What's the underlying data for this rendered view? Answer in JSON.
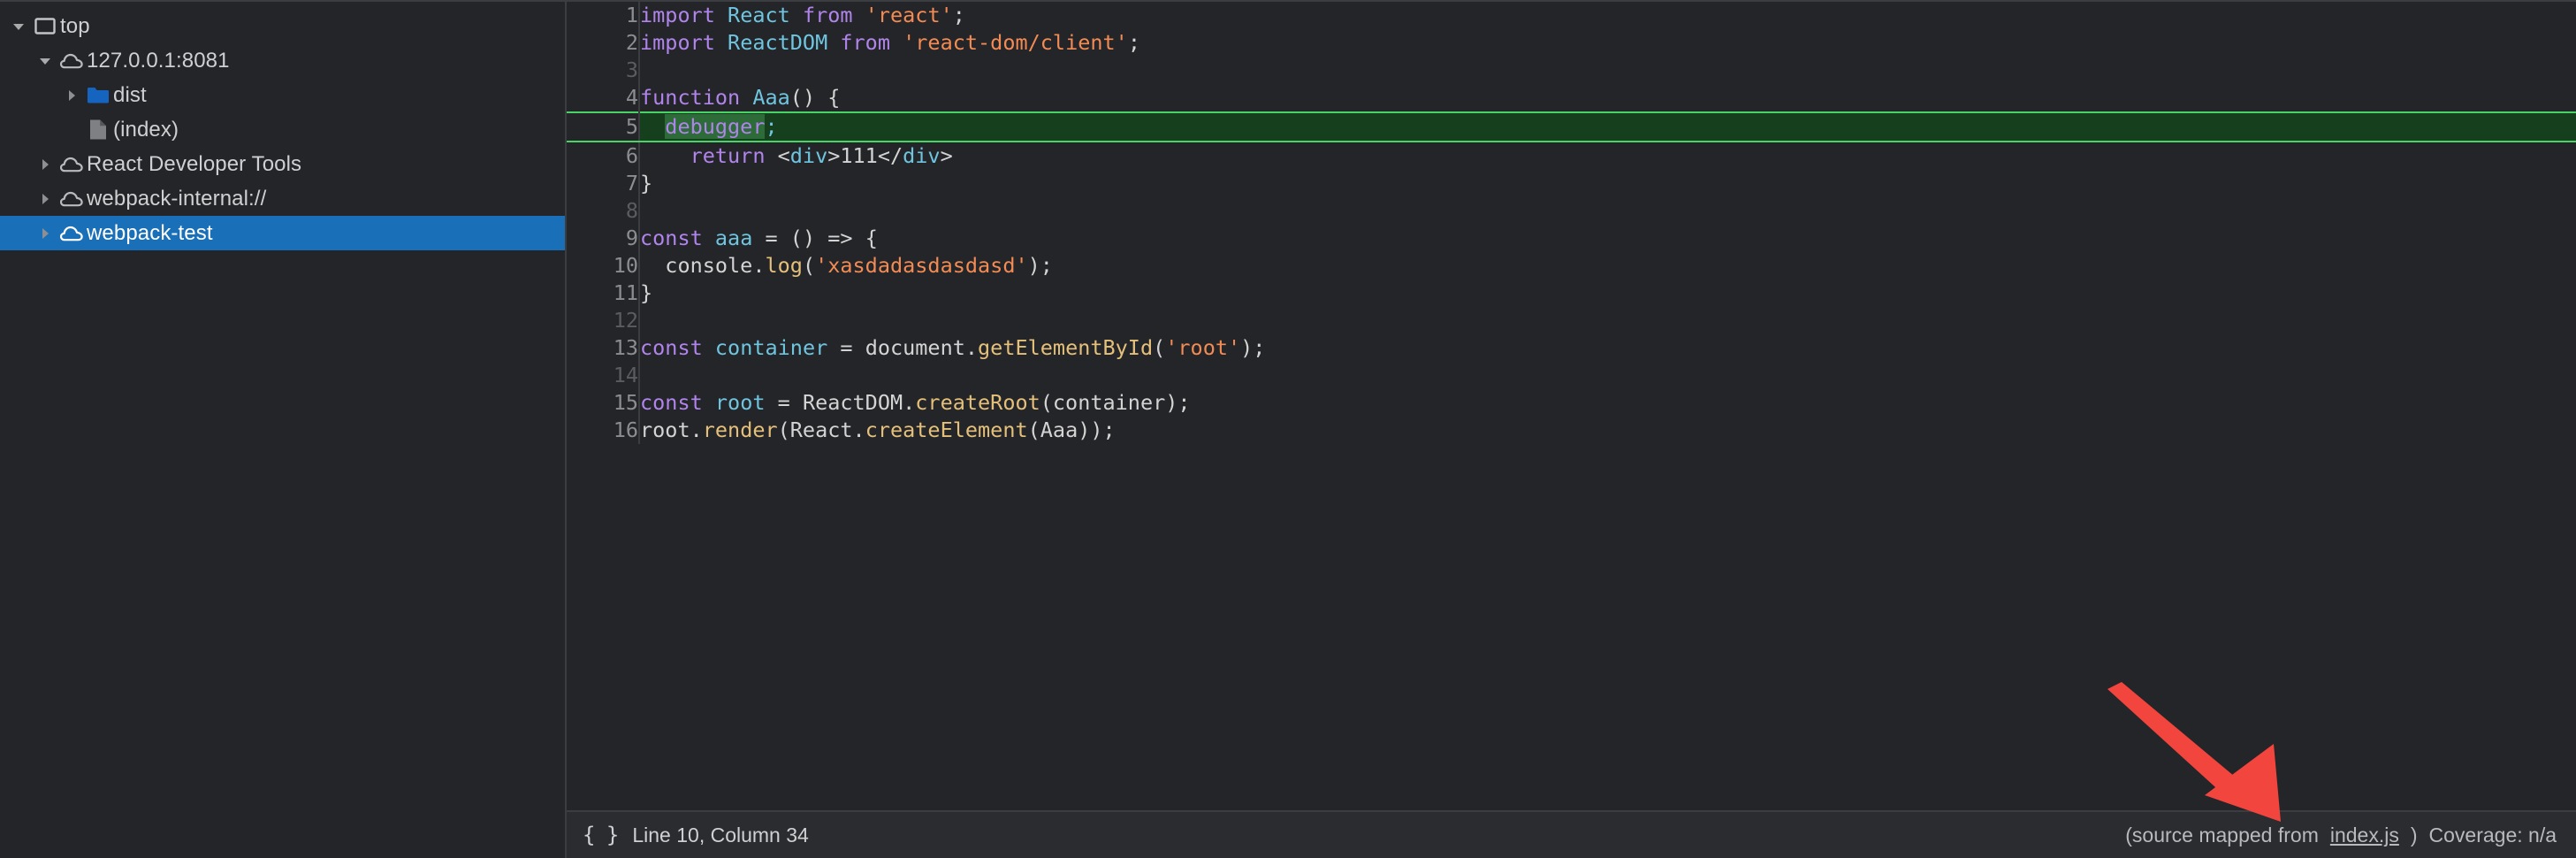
{
  "navigator": {
    "tree": [
      {
        "label": "top",
        "icon": "frame-icon",
        "twisty": "expanded",
        "indent": 0,
        "selected": false
      },
      {
        "label": "127.0.0.1:8081",
        "icon": "cloud-icon",
        "twisty": "expanded",
        "indent": 1,
        "selected": false
      },
      {
        "label": "dist",
        "icon": "folder-icon",
        "twisty": "collapsed",
        "indent": 2,
        "selected": false
      },
      {
        "label": "(index)",
        "icon": "file-icon",
        "twisty": "none",
        "indent": 2,
        "selected": false
      },
      {
        "label": "React Developer Tools",
        "icon": "cloud-icon",
        "twisty": "collapsed",
        "indent": 1,
        "selected": false
      },
      {
        "label": "webpack-internal://",
        "icon": "cloud-icon",
        "twisty": "collapsed",
        "indent": 1,
        "selected": false
      },
      {
        "label": "webpack-test",
        "icon": "cloud-icon",
        "twisty": "collapsed",
        "indent": 1,
        "selected": true
      }
    ],
    "selection_color": "#1a70b8"
  },
  "editor": {
    "language": "javascript",
    "paused_line": 5,
    "lines": [
      {
        "n": 1,
        "blank": false,
        "exec": false,
        "tokens": [
          {
            "t": "import",
            "c": "kw"
          },
          {
            "t": " ",
            "c": "plain"
          },
          {
            "t": "React",
            "c": "var"
          },
          {
            "t": " ",
            "c": "plain"
          },
          {
            "t": "from",
            "c": "kw"
          },
          {
            "t": " ",
            "c": "plain"
          },
          {
            "t": "'react'",
            "c": "str"
          },
          {
            "t": ";",
            "c": "punc"
          }
        ]
      },
      {
        "n": 2,
        "blank": false,
        "exec": false,
        "tokens": [
          {
            "t": "import",
            "c": "kw"
          },
          {
            "t": " ",
            "c": "plain"
          },
          {
            "t": "ReactDOM",
            "c": "var"
          },
          {
            "t": " ",
            "c": "plain"
          },
          {
            "t": "from",
            "c": "kw"
          },
          {
            "t": " ",
            "c": "plain"
          },
          {
            "t": "'react-dom/client'",
            "c": "str"
          },
          {
            "t": ";",
            "c": "punc"
          }
        ]
      },
      {
        "n": 3,
        "blank": true,
        "exec": false,
        "tokens": []
      },
      {
        "n": 4,
        "blank": false,
        "exec": false,
        "tokens": [
          {
            "t": "function",
            "c": "kw"
          },
          {
            "t": " ",
            "c": "plain"
          },
          {
            "t": "Aaa",
            "c": "var"
          },
          {
            "t": "() {",
            "c": "punc"
          }
        ]
      },
      {
        "n": 5,
        "blank": false,
        "exec": true,
        "tokens": [
          {
            "t": "  ",
            "c": "plain"
          },
          {
            "t": "debugger",
            "c": "kw paused"
          },
          {
            "t": ";",
            "c": "var"
          }
        ]
      },
      {
        "n": 6,
        "blank": false,
        "exec": false,
        "tokens": [
          {
            "t": "    ",
            "c": "plain"
          },
          {
            "t": "return",
            "c": "kw"
          },
          {
            "t": " <",
            "c": "punc"
          },
          {
            "t": "div",
            "c": "var"
          },
          {
            "t": ">",
            "c": "punc"
          },
          {
            "t": "111",
            "c": "num"
          },
          {
            "t": "</",
            "c": "punc"
          },
          {
            "t": "div",
            "c": "var"
          },
          {
            "t": ">",
            "c": "punc"
          }
        ]
      },
      {
        "n": 7,
        "blank": false,
        "exec": false,
        "tokens": [
          {
            "t": "}",
            "c": "punc"
          }
        ]
      },
      {
        "n": 8,
        "blank": true,
        "exec": false,
        "tokens": []
      },
      {
        "n": 9,
        "blank": false,
        "exec": false,
        "tokens": [
          {
            "t": "const",
            "c": "kw"
          },
          {
            "t": " ",
            "c": "plain"
          },
          {
            "t": "aaa",
            "c": "var"
          },
          {
            "t": " = () => {",
            "c": "punc"
          }
        ]
      },
      {
        "n": 10,
        "blank": false,
        "exec": false,
        "tokens": [
          {
            "t": "  console.",
            "c": "plain"
          },
          {
            "t": "log",
            "c": "fn"
          },
          {
            "t": "(",
            "c": "punc"
          },
          {
            "t": "'xasdadasdasdasd'",
            "c": "str"
          },
          {
            "t": ");",
            "c": "punc"
          }
        ]
      },
      {
        "n": 11,
        "blank": false,
        "exec": false,
        "tokens": [
          {
            "t": "}",
            "c": "punc"
          }
        ]
      },
      {
        "n": 12,
        "blank": true,
        "exec": false,
        "tokens": []
      },
      {
        "n": 13,
        "blank": false,
        "exec": false,
        "tokens": [
          {
            "t": "const",
            "c": "kw"
          },
          {
            "t": " ",
            "c": "plain"
          },
          {
            "t": "container",
            "c": "var"
          },
          {
            "t": " = document.",
            "c": "plain"
          },
          {
            "t": "getElementById",
            "c": "fn"
          },
          {
            "t": "(",
            "c": "punc"
          },
          {
            "t": "'root'",
            "c": "str"
          },
          {
            "t": ");",
            "c": "punc"
          }
        ]
      },
      {
        "n": 14,
        "blank": true,
        "exec": false,
        "tokens": []
      },
      {
        "n": 15,
        "blank": false,
        "exec": false,
        "tokens": [
          {
            "t": "const",
            "c": "kw"
          },
          {
            "t": " ",
            "c": "plain"
          },
          {
            "t": "root",
            "c": "var"
          },
          {
            "t": " = ReactDOM.",
            "c": "plain"
          },
          {
            "t": "createRoot",
            "c": "fn"
          },
          {
            "t": "(container);",
            "c": "punc"
          }
        ]
      },
      {
        "n": 16,
        "blank": false,
        "exec": false,
        "tokens": [
          {
            "t": "root.",
            "c": "plain"
          },
          {
            "t": "render",
            "c": "fn"
          },
          {
            "t": "(React.",
            "c": "punc"
          },
          {
            "t": "createElement",
            "c": "fn"
          },
          {
            "t": "(Aaa));",
            "c": "punc"
          }
        ]
      }
    ]
  },
  "status_bar": {
    "pretty_print_icon": "{ }",
    "cursor_position": "Line 10, Column 34",
    "source_map_prefix": "(source mapped from",
    "source_map_link": "index.js",
    "source_map_suffix": ")",
    "coverage": "Coverage: n/a"
  },
  "annotation": {
    "arrow_color": "#f2453d",
    "arrow_direction": "down-right"
  },
  "theme": {
    "background": "#242528",
    "panel_background": "#2b2c30",
    "border": "#3b3d40",
    "text": "#cfd0d2",
    "keyword": "#b084eb",
    "variable": "#6fc5e0",
    "string": "#f28b54",
    "function": "#e5c07b",
    "exec_line_bg": "#16401d",
    "exec_line_border": "#4ad468"
  }
}
